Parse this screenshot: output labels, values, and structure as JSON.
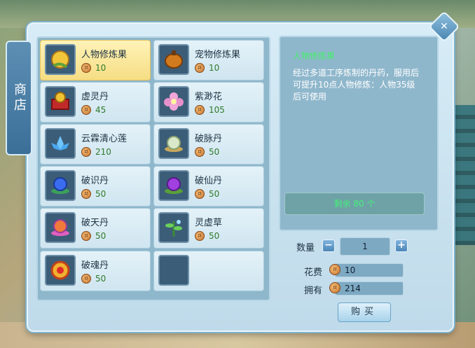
{
  "shop_tab": {
    "label": "商店"
  },
  "items": [
    {
      "name": "人物修炼果",
      "price": "10",
      "selected": true
    },
    {
      "name": "宠物修炼果",
      "price": "10"
    },
    {
      "name": "虚灵丹",
      "price": "45"
    },
    {
      "name": "紫渺花",
      "price": "105"
    },
    {
      "name": "云霖清心莲",
      "price": "210"
    },
    {
      "name": "破脉丹",
      "price": "50"
    },
    {
      "name": "破识丹",
      "price": "50"
    },
    {
      "name": "破仙丹",
      "price": "50"
    },
    {
      "name": "破天丹",
      "price": "50"
    },
    {
      "name": "灵虚草",
      "price": "50"
    },
    {
      "name": "破魂丹",
      "price": "50"
    }
  ],
  "detail": {
    "title": "人物修炼果",
    "description": "经过多道工序炼制的丹药，服用后可提升10点人物修炼：人物35级后可使用",
    "remaining": "剩余 80 个"
  },
  "purchase": {
    "quantity_label": "数量",
    "minus": "−",
    "quantity": "1",
    "plus": "+",
    "cost_label": "花费",
    "cost": "10",
    "owned_label": "拥有",
    "owned": "214",
    "buy_label": "购买"
  },
  "colors": {
    "accent_green": "#44f06a",
    "selected_slot": "#f6dd84",
    "price_green": "#2f7a2a"
  },
  "icons": {
    "coin": "coin-icon",
    "close": "close-icon"
  }
}
